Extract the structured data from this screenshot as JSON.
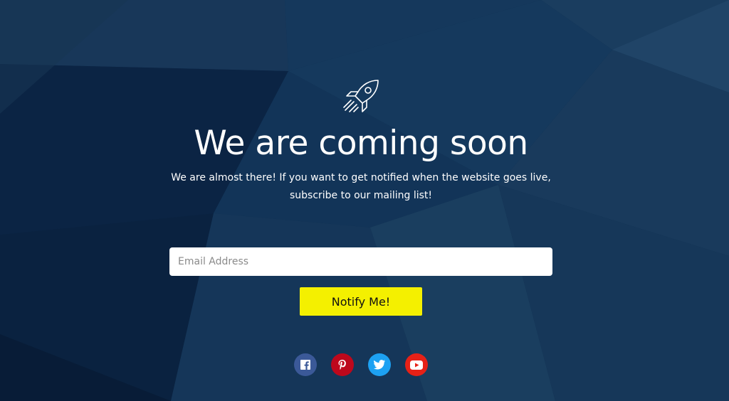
{
  "page": {
    "headline": "We are coming soon",
    "subtext": "We are almost there! If you want to get notified when the website goes live, subscribe to our mailing list!"
  },
  "form": {
    "email_placeholder": "Email Address",
    "email_value": "",
    "submit_label": "Notify Me!"
  },
  "social": [
    {
      "name": "facebook",
      "icon": "facebook-icon",
      "color": "#3b5998"
    },
    {
      "name": "pinterest",
      "icon": "pinterest-icon",
      "color": "#bd081c"
    },
    {
      "name": "twitter",
      "icon": "twitter-icon",
      "color": "#1da1f2"
    },
    {
      "name": "youtube",
      "icon": "youtube-icon",
      "color": "#e62117"
    }
  ],
  "colors": {
    "background": "#0f2c4c",
    "accent": "#f4f000",
    "text": "#ffffff"
  }
}
